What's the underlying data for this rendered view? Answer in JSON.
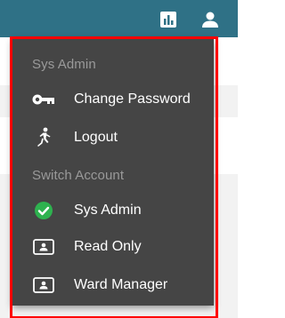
{
  "topbar": {
    "icons": [
      "bar-chart-icon",
      "user-icon"
    ],
    "background_color": "#2f7186"
  },
  "menu": {
    "sections": [
      {
        "label": "Sys Admin",
        "items": [
          {
            "label": "Change Password",
            "icon": "key-icon"
          },
          {
            "label": "Logout",
            "icon": "running-person-icon"
          }
        ]
      },
      {
        "label": "Switch Account",
        "items": [
          {
            "label": "Sys Admin",
            "icon": "check-circle-icon",
            "selected": true
          },
          {
            "label": "Read Only",
            "icon": "id-card-icon"
          },
          {
            "label": "Ward Manager",
            "icon": "id-card-icon"
          }
        ]
      }
    ],
    "background_color": "#454545",
    "selected_color": "#2eb24f",
    "highlight_color": "#ff0000"
  }
}
